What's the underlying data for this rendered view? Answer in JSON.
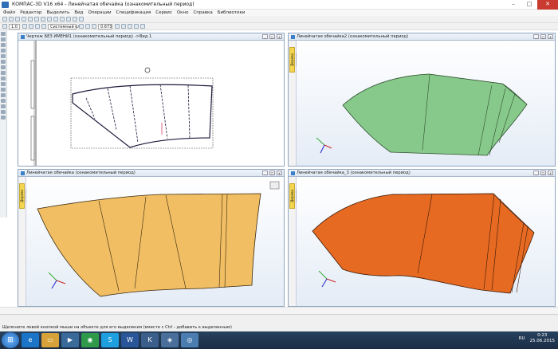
{
  "window": {
    "title": "КОМПАС-3D V16  x64 - Линейчатая обечайка (ознакомительный период)"
  },
  "menu": [
    "Файл",
    "Редактор",
    "Выделить",
    "Вид",
    "Операции",
    "Спецификация",
    "Сервис",
    "Окно",
    "Справка",
    "Библиотеки"
  ],
  "toolbar": {
    "scale_value": "1.0",
    "style_value": "Системный сл",
    "zoom_value": "0.673"
  },
  "windows": [
    {
      "title": "Чертеж БЕЗ ИМЕНИ1 (ознакомительный период) ->Вид 1"
    },
    {
      "title": "Линейчатая обечайка2 (ознакомительный период)",
      "tree_tab": "Дерево модели",
      "fill": "#87c98a"
    },
    {
      "title": "Линейчатая обечайка (ознакомительный период)",
      "tree_tab": "Дерево модели",
      "fill": "#f1be63"
    },
    {
      "title": "Линейчатая обечайка_3 (ознакомительный период)",
      "tree_tab": "Дерево модели",
      "fill": "#e76a22"
    }
  ],
  "status": {
    "text": "Щелкните левой кнопкой мыши на объекте для его выделения (вместе с Ctrl - добавить к выделенным)"
  },
  "taskbar": {
    "apps": [
      {
        "icon": "internet-explorer-icon",
        "color": "#1b74c8"
      },
      {
        "icon": "folder-icon",
        "color": "#d8a23a"
      },
      {
        "icon": "media-player-icon",
        "color": "#3a6a9a"
      },
      {
        "icon": "chrome-icon",
        "color": "#2f9b4a"
      },
      {
        "icon": "skype-icon",
        "color": "#1ea0e0"
      },
      {
        "icon": "word-icon",
        "color": "#2a5699"
      },
      {
        "icon": "kompas-icon",
        "color": "#3b5f8a"
      },
      {
        "icon": "network-icon",
        "color": "#4a6f9a"
      },
      {
        "icon": "kompas-doc-icon",
        "color": "#4c7db0"
      }
    ],
    "lang": "RU",
    "time": "0:23",
    "date": "25.06.2015"
  }
}
